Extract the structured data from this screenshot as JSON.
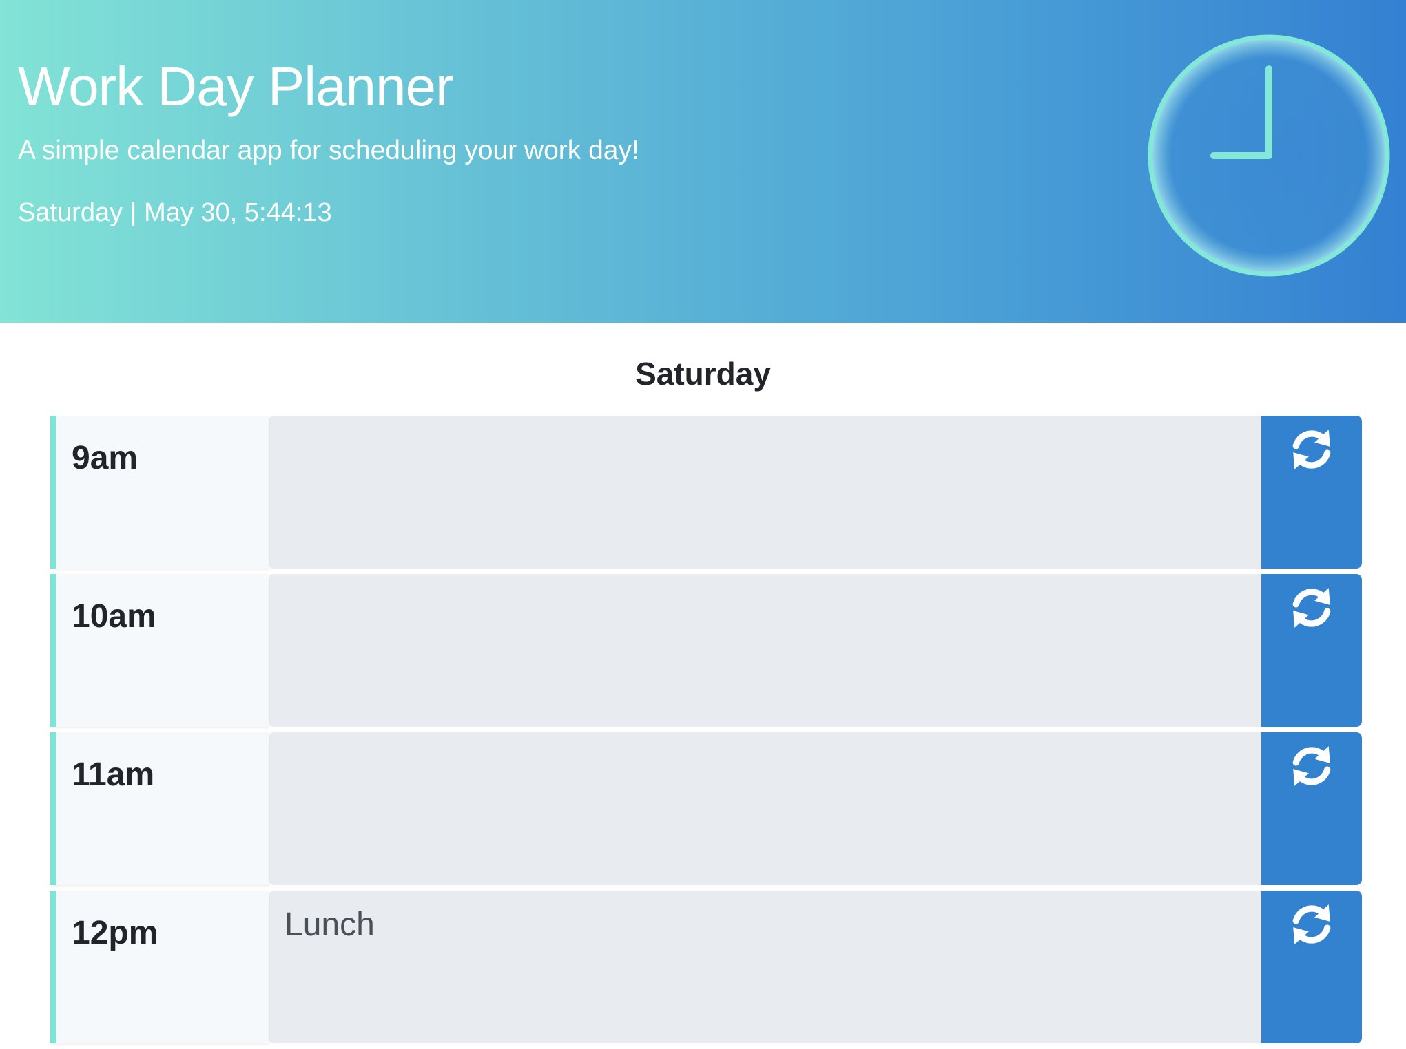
{
  "header": {
    "title": "Work Day Planner",
    "subtitle": "A simple calendar app for scheduling your work day!",
    "datetime": "Saturday | May 30, 5:44:13",
    "clock_icon": "clock-icon"
  },
  "planner": {
    "day_heading": "Saturday",
    "rows": [
      {
        "hour": "9am",
        "text": "",
        "save_icon": "refresh-icon"
      },
      {
        "hour": "10am",
        "text": "",
        "save_icon": "refresh-icon"
      },
      {
        "hour": "11am",
        "text": "",
        "save_icon": "refresh-icon"
      },
      {
        "hour": "12pm",
        "text": "Lunch",
        "save_icon": "refresh-icon"
      }
    ]
  },
  "colors": {
    "header_gradient_start": "#82e3d6",
    "header_gradient_end": "#3480d2",
    "accent_teal": "#7fe3d6",
    "save_button_blue": "#3382d0",
    "textarea_bg": "#e8ebef",
    "hour_bg": "#f6f9fc"
  }
}
